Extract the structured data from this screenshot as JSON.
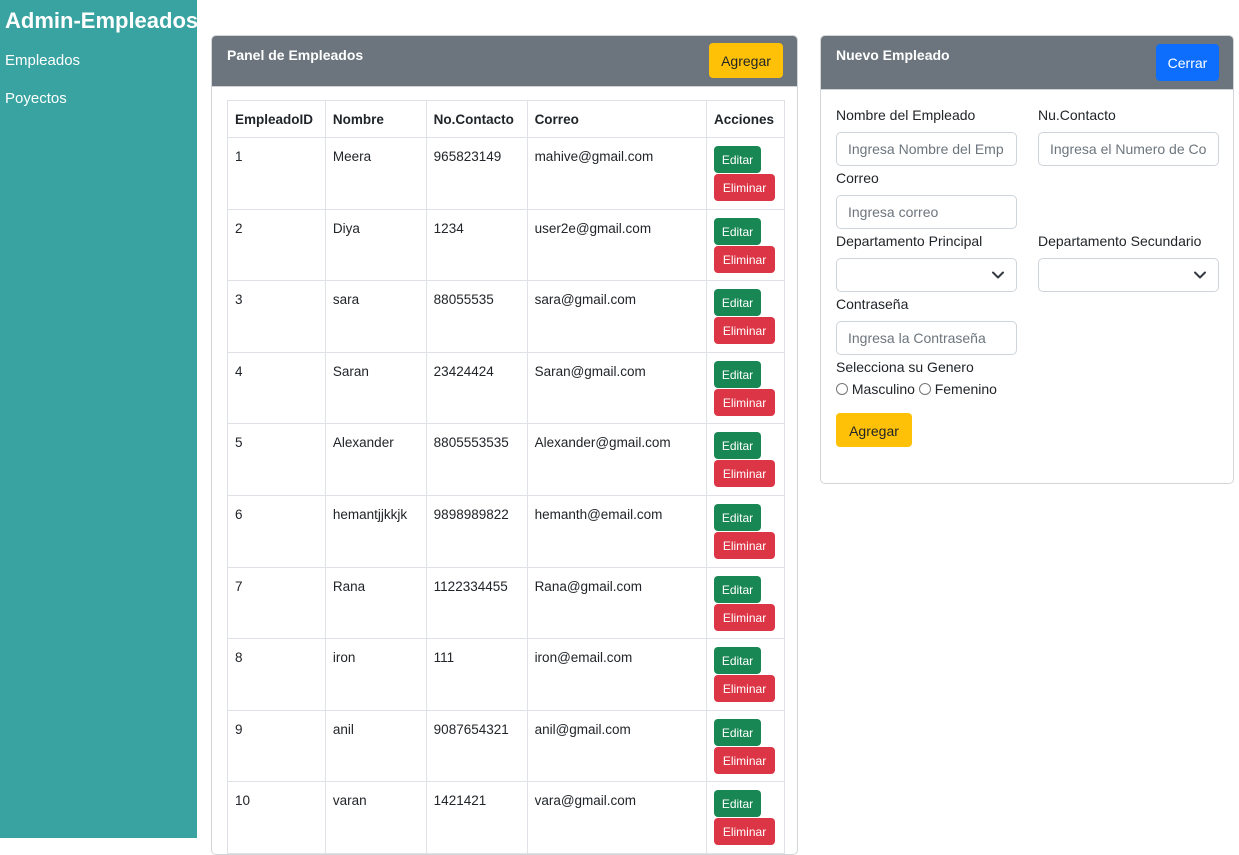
{
  "sidebar": {
    "brand": "Admin-Empleados",
    "items": [
      {
        "label": "Empleados"
      },
      {
        "label": "Poyectos"
      }
    ]
  },
  "panel": {
    "title": "Panel de Empleados",
    "add_label": "Agregar",
    "columns": [
      "EmpleadoID",
      "Nombre",
      "No.Contacto",
      "Correo",
      "Acciones"
    ],
    "edit_label": "Editar",
    "delete_label": "Eliminar",
    "rows": [
      {
        "id": "1",
        "nombre": "Meera",
        "contacto": "965823149",
        "correo": "mahive@gmail.com"
      },
      {
        "id": "2",
        "nombre": "Diya",
        "contacto": "1234",
        "correo": "user2e@gmail.com"
      },
      {
        "id": "3",
        "nombre": "sara",
        "contacto": "88055535",
        "correo": "sara@gmail.com"
      },
      {
        "id": "4",
        "nombre": "Saran",
        "contacto": "23424424",
        "correo": "Saran@gmail.com"
      },
      {
        "id": "5",
        "nombre": "Alexander",
        "contacto": "8805553535",
        "correo": "Alexander@gmail.com"
      },
      {
        "id": "6",
        "nombre": "hemantjjkkjk",
        "contacto": "9898989822",
        "correo": "hemanth@email.com"
      },
      {
        "id": "7",
        "nombre": "Rana",
        "contacto": "1122334455",
        "correo": "Rana@gmail.com"
      },
      {
        "id": "8",
        "nombre": "iron",
        "contacto": "111",
        "correo": "iron@email.com"
      },
      {
        "id": "9",
        "nombre": "anil",
        "contacto": "9087654321",
        "correo": "anil@gmail.com"
      },
      {
        "id": "10",
        "nombre": "varan",
        "contacto": "1421421",
        "correo": "vara@gmail.com"
      }
    ]
  },
  "form": {
    "title": "Nuevo Empleado",
    "close_label": "Cerrar",
    "nombre_label": "Nombre del Empleado",
    "nombre_placeholder": "Ingresa Nombre del Emp",
    "contacto_label": "Nu.Contacto",
    "contacto_placeholder": "Ingresa el Numero de Co",
    "correo_label": "Correo",
    "correo_placeholder": "Ingresa correo",
    "dep_principal_label": "Departamento Principal",
    "dep_secundario_label": "Departamento Secundario",
    "password_label": "Contraseña",
    "password_placeholder": "Ingresa la Contraseña",
    "genero_label": "Selecciona su Genero",
    "masculino_label": "Masculino",
    "femenino_label": "Femenino",
    "submit_label": "Agregar"
  },
  "colors": {
    "sidebar": "#38a3a0",
    "header": "#6c757d",
    "warning": "#ffc107",
    "primary": "#0d6efd",
    "success": "#198754",
    "danger": "#dc3545"
  }
}
